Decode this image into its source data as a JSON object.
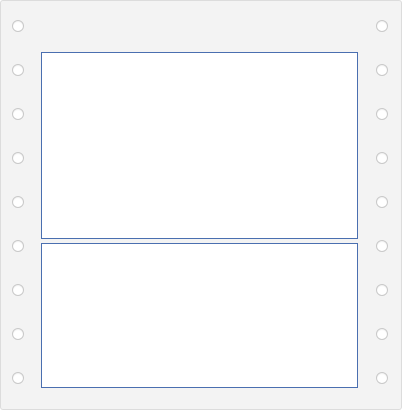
{
  "sheet": {
    "type": "continuous-form-labels",
    "labels": [
      {
        "name": "label-1",
        "content": ""
      },
      {
        "name": "label-2",
        "content": ""
      }
    ],
    "tractor_holes_per_side": 9,
    "colors": {
      "sheet_background": "#f3f3f3",
      "label_border": "#4a6fb0",
      "hole_border": "#c9c9c9"
    }
  }
}
